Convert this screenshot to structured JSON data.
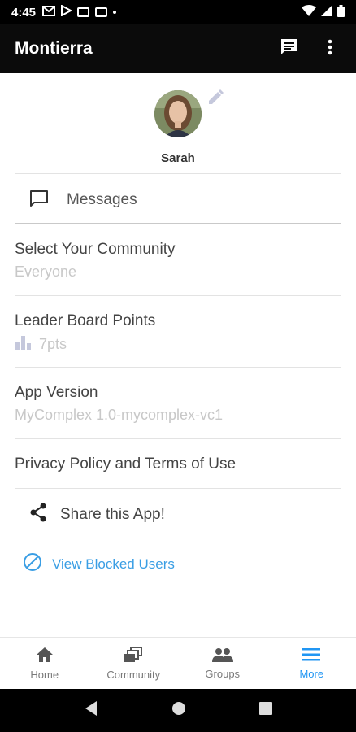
{
  "status_bar": {
    "time": "4:45"
  },
  "app_bar": {
    "title": "Montierra"
  },
  "profile": {
    "name": "Sarah"
  },
  "menu": {
    "messages": "Messages",
    "community": {
      "title": "Select Your Community",
      "value": "Everyone"
    },
    "leaderboard": {
      "title": "Leader Board Points",
      "value": "7pts"
    },
    "version": {
      "title": "App Version",
      "value": "MyComplex 1.0-mycomplex-vc1"
    },
    "privacy": "Privacy Policy and Terms of Use",
    "share": "Share this App!",
    "blocked": "View Blocked Users"
  },
  "bottom_nav": [
    {
      "label": "Home",
      "icon": "home-icon"
    },
    {
      "label": "Community",
      "icon": "community-icon"
    },
    {
      "label": "Groups",
      "icon": "groups-icon"
    },
    {
      "label": "More",
      "icon": "menu-icon",
      "active": true
    }
  ],
  "colors": {
    "accent": "#2196f3",
    "link": "#3a9ee4",
    "app_bar": "#0b0b0b"
  }
}
